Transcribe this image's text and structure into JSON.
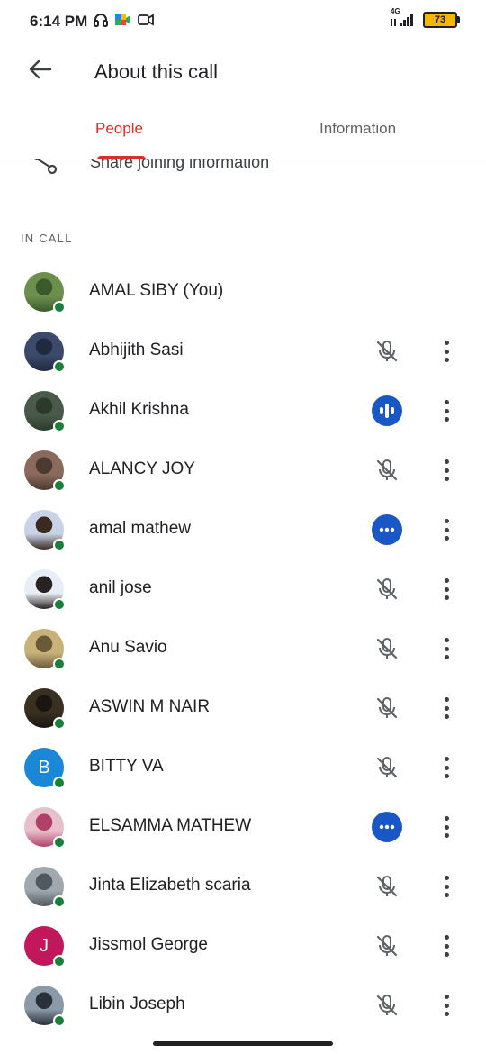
{
  "status_bar": {
    "time": "6:14 PM",
    "network": "4G",
    "battery": "73",
    "icons": [
      "headphones-icon",
      "meet-icon",
      "video-icon",
      "signal-icon"
    ]
  },
  "header": {
    "title": "About this call",
    "back_icon": "arrow-back-icon"
  },
  "tabs": [
    {
      "label": "People",
      "active": true
    },
    {
      "label": "Information",
      "active": false
    }
  ],
  "share": {
    "label": "Share joining information",
    "icon": "share-icon"
  },
  "section": {
    "label": "IN CALL"
  },
  "colors": {
    "accent_red": "#d93025",
    "presence_green": "#188038",
    "speaking_blue": "#1a57c6"
  },
  "participants": [
    {
      "name": "AMAL SIBY (You)",
      "avatar": "photo",
      "status": "none"
    },
    {
      "name": "Abhijith Sasi",
      "avatar": "photo",
      "status": "muted"
    },
    {
      "name": "Akhil Krishna",
      "avatar": "photo",
      "status": "speaking"
    },
    {
      "name": "ALANCY JOY",
      "avatar": "photo",
      "status": "muted"
    },
    {
      "name": "amal mathew",
      "avatar": "photo",
      "status": "active"
    },
    {
      "name": "anil jose",
      "avatar": "photo",
      "status": "muted"
    },
    {
      "name": "Anu Savio",
      "avatar": "photo",
      "status": "muted"
    },
    {
      "name": "ASWIN M NAIR",
      "avatar": "photo",
      "status": "muted"
    },
    {
      "name": "BITTY VA",
      "avatar": "initial",
      "initial": "B",
      "avatar_color": "#1a88d6",
      "status": "muted"
    },
    {
      "name": "ELSAMMA MATHEW",
      "avatar": "photo",
      "status": "active"
    },
    {
      "name": "Jinta Elizabeth scaria",
      "avatar": "photo",
      "status": "muted"
    },
    {
      "name": "Jissmol George",
      "avatar": "initial",
      "initial": "J",
      "avatar_color": "#c2185b",
      "status": "muted"
    },
    {
      "name": "Libin Joseph",
      "avatar": "photo",
      "status": "muted"
    }
  ]
}
